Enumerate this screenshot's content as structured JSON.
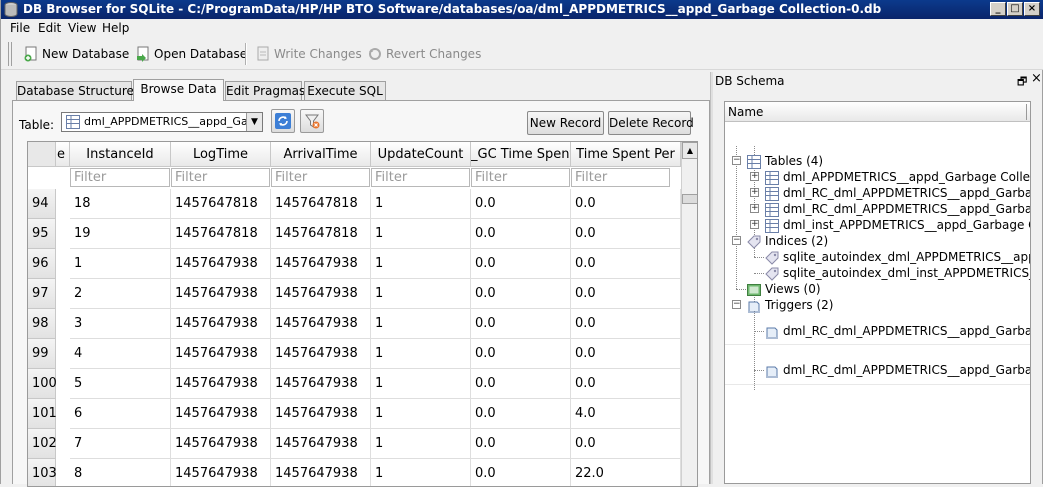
{
  "window": {
    "title": "DB Browser for SQLite - C:/ProgramData/HP/HP BTO Software/databases/oa/dml_APPDMETRICS__appd_Garbage Collection-0.db",
    "minimize": "_",
    "maximize": "□",
    "close": "×"
  },
  "menu": [
    "File",
    "Edit",
    "View",
    "Help"
  ],
  "toolbar": {
    "new_database": "New Database",
    "open_database": "Open Database",
    "write_changes": "Write Changes",
    "revert_changes": "Revert Changes"
  },
  "tabs": [
    "Database Structure",
    "Browse Data",
    "Edit Pragmas",
    "Execute SQL"
  ],
  "active_tab": "Browse Data",
  "browse": {
    "table_label": "Table:",
    "table_value": "dml_APPDMETRICS__appd_Garbage Collection",
    "new_record": "New Record",
    "delete_record": "Delete Record",
    "filter_placeholder": "Filter",
    "columns": [
      "e",
      "InstanceId",
      "LogTime",
      "ArrivalTime",
      "UpdateCount",
      "_GC Time Spent",
      "Time Spent Per"
    ],
    "rows": [
      {
        "n": "94",
        "cells": [
          "18",
          "1457647818",
          "1457647818",
          "1",
          "0.0",
          "0.0"
        ]
      },
      {
        "n": "95",
        "cells": [
          "19",
          "1457647818",
          "1457647818",
          "1",
          "0.0",
          "0.0"
        ]
      },
      {
        "n": "96",
        "cells": [
          "1",
          "1457647938",
          "1457647938",
          "1",
          "0.0",
          "0.0"
        ]
      },
      {
        "n": "97",
        "cells": [
          "2",
          "1457647938",
          "1457647938",
          "1",
          "0.0",
          "0.0"
        ]
      },
      {
        "n": "98",
        "cells": [
          "3",
          "1457647938",
          "1457647938",
          "1",
          "0.0",
          "0.0"
        ]
      },
      {
        "n": "99",
        "cells": [
          "4",
          "1457647938",
          "1457647938",
          "1",
          "0.0",
          "0.0"
        ]
      },
      {
        "n": "100",
        "cells": [
          "5",
          "1457647938",
          "1457647938",
          "1",
          "0.0",
          "0.0"
        ]
      },
      {
        "n": "101",
        "cells": [
          "6",
          "1457647938",
          "1457647938",
          "1",
          "0.0",
          "4.0"
        ]
      },
      {
        "n": "102",
        "cells": [
          "7",
          "1457647938",
          "1457647938",
          "1",
          "0.0",
          "0.0"
        ]
      },
      {
        "n": "103",
        "cells": [
          "8",
          "1457647938",
          "1457647938",
          "1",
          "0.0",
          "22.0"
        ]
      }
    ]
  },
  "schema": {
    "title": "DB Schema",
    "undock": "🗗",
    "close": "×",
    "header": "Name",
    "tables_group": "Tables (4)",
    "tables": [
      "dml_APPDMETRICS__appd_Garbage Collection",
      "dml_RC_dml_APPDMETRICS__appd_Garbage ...",
      "dml_RC_dml_APPDMETRICS__appd_Garbage ...",
      "dml_inst_APPDMETRICS__appd_Garbage Coll..."
    ],
    "indices_group": "Indices (2)",
    "indices": [
      "sqlite_autoindex_dml_APPDMETRICS__appd_...",
      "sqlite_autoindex_dml_inst_APPDMETRICS__a..."
    ],
    "views_group": "Views (0)",
    "triggers_group": "Triggers (2)",
    "triggers": [
      "dml_RC_dml_APPDMETRICS__appd_Garbage ...",
      "dml_RC_dml_APPDMETRICS__appd_Garbage ..."
    ]
  }
}
